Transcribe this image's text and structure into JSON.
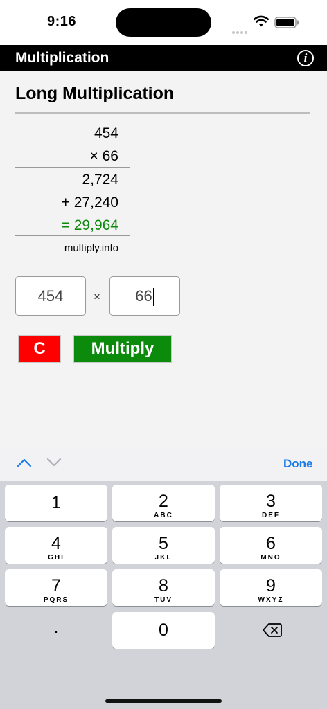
{
  "status_bar": {
    "time": "9:16"
  },
  "app": {
    "title": "Multiplication"
  },
  "page": {
    "heading": "Long Multiplication",
    "calculation": {
      "multiplicand": "454",
      "multiplier_line": "× 66",
      "partial_1": "2,724",
      "partial_2": "+ 27,240",
      "result_line": "= 29,964"
    },
    "credit": "multiply.info"
  },
  "form": {
    "first_value": "454",
    "times_sign": "×",
    "second_value": "66",
    "clear_label": "C",
    "multiply_label": "Multiply"
  },
  "keyboard_toolbar": {
    "done_label": "Done"
  },
  "keyboard": {
    "keys": [
      {
        "num": "1",
        "letters": ""
      },
      {
        "num": "2",
        "letters": "ABC"
      },
      {
        "num": "3",
        "letters": "DEF"
      },
      {
        "num": "4",
        "letters": "GHI"
      },
      {
        "num": "5",
        "letters": "JKL"
      },
      {
        "num": "6",
        "letters": "MNO"
      },
      {
        "num": "7",
        "letters": "PQRS"
      },
      {
        "num": "8",
        "letters": "TUV"
      },
      {
        "num": "9",
        "letters": "WXYZ"
      },
      {
        "num": "0",
        "letters": ""
      }
    ],
    "dot_label": "."
  },
  "colors": {
    "appbar": "#000000",
    "result_green": "#0d8a0d",
    "clear_button": "#ff0000",
    "multiply_button": "#0b8a0b",
    "done_blue": "#1a7be8"
  }
}
